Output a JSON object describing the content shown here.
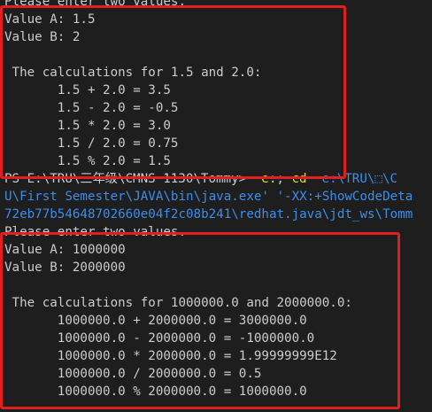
{
  "terminal": {
    "block1": {
      "prompt_line": "Please enter two values.",
      "value_a": "Value A: 1.5",
      "value_b": "Value B: 2",
      "blank": "",
      "heading": " The calculations for 1.5 and 2.0:",
      "ops": [
        "       1.5 + 2.0 = 3.5",
        "       1.5 - 2.0 = -0.5",
        "       1.5 * 2.0 = 3.0",
        "       1.5 / 2.0 = 0.75",
        "       1.5 % 2.0 = 1.5"
      ]
    },
    "ps_line": {
      "prompt": "PS E:\\TRU\\三年级\\CMNS 1130\\Tommy> ",
      "cmd": " e:",
      "sep": "; ",
      "cd": "cd",
      "path": "  e:\\TRU\\⬚\\C"
    },
    "wrap_line_1": "U\\First Semester\\JAVA\\bin\\java.exe' '-XX:+ShowCodeDeta",
    "wrap_line_2": "72eb77b54648702660e04f2c08b241\\redhat.java\\jdt_ws\\Tomm",
    "block2": {
      "prompt_line": "Please enter two values.",
      "value_a": "Value A: 1000000",
      "value_b": "Value B: 2000000",
      "blank": "",
      "heading": " The calculations for 1000000.0 and 2000000.0:",
      "ops": [
        "       1000000.0 + 2000000.0 = 3000000.0",
        "       1000000.0 - 2000000.0 = -1000000.0",
        "       1000000.0 * 2000000.0 = 1.99999999E12",
        "       1000000.0 / 2000000.0 = 0.5",
        "       1000000.0 % 2000000.0 = 1000000.0"
      ]
    }
  },
  "colors": {
    "background": "#1e1e1e",
    "text": "#cccccc",
    "highlight_border": "#e0201f",
    "command": "#dcdc4a",
    "path": "#3b8eea"
  }
}
